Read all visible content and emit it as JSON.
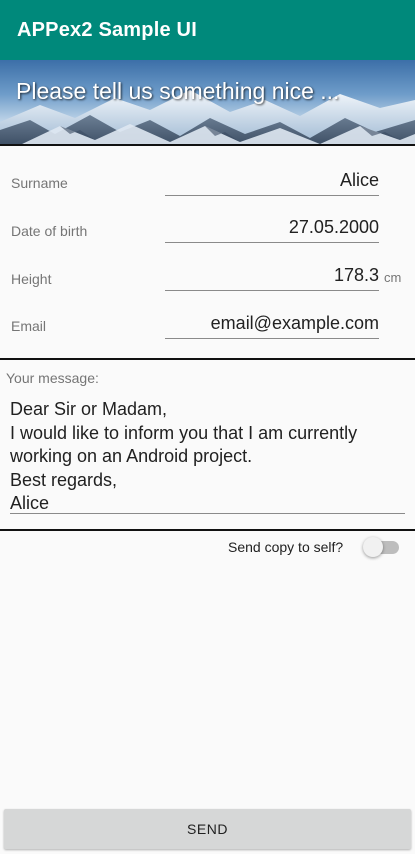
{
  "app_bar": {
    "title": "APPex2 Sample UI",
    "color": "#00897b"
  },
  "banner": {
    "text": "Please tell us something nice ..."
  },
  "form": {
    "surname": {
      "label": "Surname",
      "value": "Alice"
    },
    "date_of_birth": {
      "label": "Date of birth",
      "value": "27.05.2000"
    },
    "height": {
      "label": "Height",
      "value": "178.3",
      "unit": "cm"
    },
    "email": {
      "label": "Email",
      "value": "email@example.com"
    }
  },
  "message": {
    "label": "Your message:",
    "lines": [
      "Dear Sir or Madam,",
      "I would like to inform you that I am currently",
      "working on an Android project.",
      "Best regards,",
      "Alice"
    ]
  },
  "copy_to_self": {
    "label": "Send copy to self?",
    "checked": false
  },
  "send_button": {
    "label": "SEND"
  }
}
